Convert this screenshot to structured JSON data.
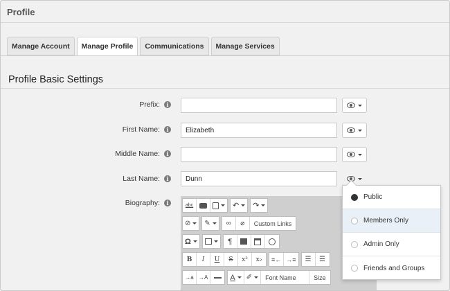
{
  "page": {
    "title": "Profile"
  },
  "tabs": [
    {
      "label": "Manage Account",
      "active": false
    },
    {
      "label": "Manage Profile",
      "active": true
    },
    {
      "label": "Communications",
      "active": false
    },
    {
      "label": "Manage Services",
      "active": false
    }
  ],
  "section": {
    "title": "Profile Basic Settings"
  },
  "fields": {
    "prefix": {
      "label": "Prefix:",
      "value": ""
    },
    "first_name": {
      "label": "First Name:",
      "value": "Elizabeth"
    },
    "middle_name": {
      "label": "Middle Name:",
      "value": ""
    },
    "last_name": {
      "label": "Last Name:",
      "value": "Dunn"
    },
    "biography": {
      "label": "Biography:"
    }
  },
  "info_icon_glyph": "i",
  "editor": {
    "spellcheck_label": "abc",
    "custom_links_label": "Custom Links",
    "bold": "B",
    "italic": "I",
    "underline": "U",
    "strike": "S",
    "superscript": "x²",
    "subscript": "x₂",
    "special_char": "Ω",
    "pilcrow": "¶",
    "font_color_glyph": "A",
    "indent_small": "→a",
    "indent_large": "→A",
    "font_name_label": "Font Name",
    "size_label": "Size"
  },
  "visibility_menu": {
    "options": [
      {
        "label": "Public",
        "selected": true
      },
      {
        "label": "Members Only",
        "selected": false,
        "highlighted": true
      },
      {
        "label": "Admin Only",
        "selected": false
      },
      {
        "label": "Friends and Groups",
        "selected": false
      }
    ]
  },
  "colors": {
    "background": "#f1f1f1",
    "editor_bg": "#cfcfcf",
    "menu_highlight": "#e9f0f8"
  }
}
